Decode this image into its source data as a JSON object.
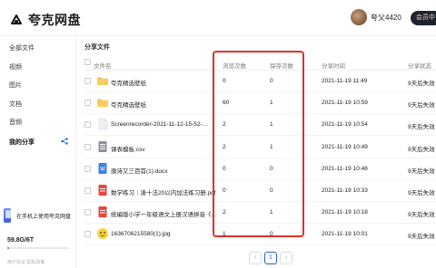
{
  "app": {
    "name": "夸克网盘"
  },
  "user": {
    "name": "夸父4420",
    "vip_label": "会员中"
  },
  "sidebar": {
    "items": [
      {
        "label": "全部文件"
      },
      {
        "label": "视频"
      },
      {
        "label": "图片"
      },
      {
        "label": "文档"
      },
      {
        "label": "音频"
      },
      {
        "label": "我的分享"
      }
    ],
    "promo_text": "在手机上使用夸克网盘",
    "storage_text": "59.8G/6T",
    "storage_used_fraction": 0.01,
    "footer_links": "用户协议  隐私政策"
  },
  "main": {
    "title": "分享文件",
    "columns": [
      "文件名",
      "浏览次数",
      "保存次数",
      "分享时间",
      "分享状态"
    ],
    "rows": [
      {
        "icon": "folder-icon",
        "name": "夸克精选壁纸",
        "views": "0",
        "saves": "0",
        "time": "2021-11-19 11:49",
        "status": "9天后失效"
      },
      {
        "icon": "folder-icon",
        "name": "夸克精选壁纸",
        "views": "60",
        "saves": "1",
        "time": "2021-11-19 10:59",
        "status": "9天后失效"
      },
      {
        "icon": "file-icon",
        "name": "Screenrecorder-2021-11-12-15-52-…",
        "views": "2",
        "saves": "1",
        "time": "2021-11-19 10:54",
        "status": "9天后失效"
      },
      {
        "icon": "csv-icon",
        "name": "课表模板.csv",
        "views": "2",
        "saves": "1",
        "time": "2021-11-19 10:49",
        "status": "9天后失效"
      },
      {
        "icon": "doc-icon",
        "name": "唐诗又三百首(1).docx",
        "views": "0",
        "saves": "0",
        "time": "2021-11-19 10:46",
        "status": "9天后失效"
      },
      {
        "icon": "pdf-icon",
        "name": "数学练习｜凑十法20以内加法练习册.pdf",
        "views": "0",
        "saves": "0",
        "time": "2021-11-19 10:33",
        "status": "9天后失效"
      },
      {
        "icon": "pdf-icon",
        "name": "统编版小学一年级语文上册汉语拼音《…",
        "views": "2",
        "saves": "1",
        "time": "2021-11-19 10:18",
        "status": "9天后失效"
      },
      {
        "icon": "image-icon",
        "name": "1636706215580(1).jpg",
        "views": "1",
        "saves": "0",
        "time": "2021-11-19 10:01",
        "status": "9天后失效"
      }
    ]
  },
  "pagination": {
    "prev": "‹",
    "current": "1",
    "next": "›"
  },
  "colors": {
    "highlight": "#e0312b",
    "accent": "#2a5bd7",
    "folder": "#f5c04a"
  }
}
